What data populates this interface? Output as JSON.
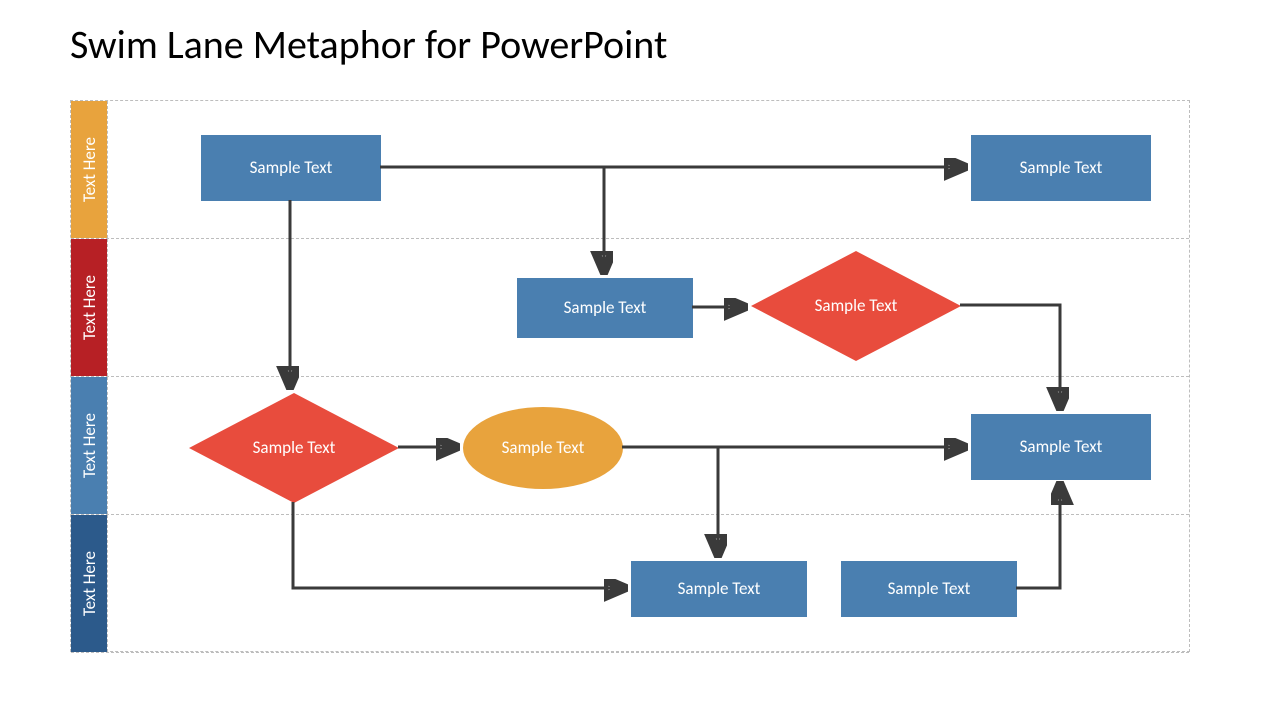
{
  "title": "Swim Lane Metaphor for PowerPoint",
  "colors": {
    "process": "#4a7fb0",
    "decision": "#e84c3d",
    "terminator": "#e8a33d",
    "lane1": "#e8a33d",
    "lane2": "#b72025",
    "lane3": "#4a7fb0",
    "lane4": "#2c5a8b",
    "connector": "#3a3a3a"
  },
  "lanes": [
    {
      "label": "Text Here"
    },
    {
      "label": "Text Here"
    },
    {
      "label": "Text Here"
    },
    {
      "label": "Text Here"
    }
  ],
  "nodes": {
    "n1": {
      "lane": 0,
      "type": "process",
      "label": "Sample Text"
    },
    "n2": {
      "lane": 0,
      "type": "process",
      "label": "Sample Text"
    },
    "n3": {
      "lane": 1,
      "type": "process",
      "label": "Sample Text"
    },
    "n4": {
      "lane": 1,
      "type": "decision",
      "label": "Sample Text"
    },
    "n5": {
      "lane": 2,
      "type": "decision",
      "label": "Sample Text"
    },
    "n6": {
      "lane": 2,
      "type": "terminator",
      "label": "Sample Text"
    },
    "n7": {
      "lane": 2,
      "type": "process",
      "label": "Sample Text"
    },
    "n8": {
      "lane": 3,
      "type": "process",
      "label": "Sample Text"
    },
    "n9": {
      "lane": 3,
      "type": "process",
      "label": "Sample Text"
    }
  },
  "edges": [
    {
      "from": "n1",
      "to": "n2",
      "kind": "straight"
    },
    {
      "from": "n1-n2-mid",
      "to": "n3",
      "kind": "branch-down"
    },
    {
      "from": "n1",
      "to": "n5",
      "kind": "down"
    },
    {
      "from": "n3",
      "to": "n4",
      "kind": "straight"
    },
    {
      "from": "n4",
      "to": "n7",
      "kind": "elbow-right-down"
    },
    {
      "from": "n5",
      "to": "n6",
      "kind": "straight"
    },
    {
      "from": "n6",
      "to": "n7",
      "kind": "straight"
    },
    {
      "from": "n6-n7-mid",
      "to": "n8",
      "kind": "branch-down"
    },
    {
      "from": "n5",
      "to": "n8",
      "kind": "elbow-down-right"
    },
    {
      "from": "n9",
      "to": "n7",
      "kind": "elbow-right-up"
    }
  ]
}
